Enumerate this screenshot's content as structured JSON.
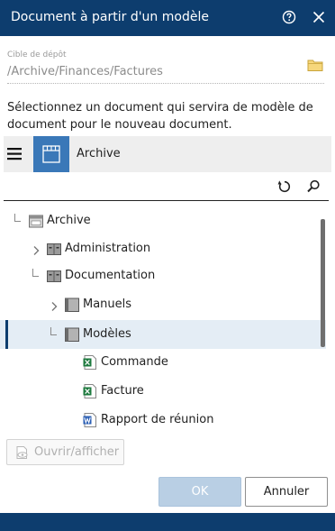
{
  "dialog": {
    "title": "Document à partir d'un modèle"
  },
  "titlebar_icons": [
    "help-icon",
    "close-icon"
  ],
  "target": {
    "label": "Cible de dépôt",
    "value": "/Archive/Finances/Factures",
    "icon": "folder-icon"
  },
  "instructions": "Sélectionnez un document qui servira de modèle de document pour le nouveau document.",
  "toolbar": {
    "archive_label": "Archive",
    "icons": [
      "menu-icon",
      "archive-icon",
      "refresh-icon",
      "search-icon"
    ]
  },
  "tree": {
    "items": [
      {
        "label": "Archive",
        "icon": "archive-root-icon",
        "expander": "none"
      },
      {
        "label": "Administration",
        "icon": "cabinet-icon",
        "expander": "collapsed"
      },
      {
        "label": "Documentation",
        "icon": "cabinet-icon",
        "expander": "expanded"
      },
      {
        "label": "Manuels",
        "icon": "folder-gray-icon",
        "expander": "collapsed"
      },
      {
        "label": "Modèles",
        "icon": "folder-gray-icon",
        "expander": "expanded",
        "selected": true
      },
      {
        "label": "Commande",
        "icon": "excel-file-icon",
        "expander": "none"
      },
      {
        "label": "Facture",
        "icon": "excel-file-icon",
        "expander": "none"
      },
      {
        "label": "Rapport de réunion",
        "icon": "word-file-icon",
        "expander": "none"
      }
    ]
  },
  "buttons": {
    "open": "Ouvrir/afficher",
    "ok": "OK",
    "cancel": "Annuler"
  },
  "colors": {
    "titlebar": "#0d3d6e",
    "accent": "#3a78b8",
    "selection": "#e4edf5",
    "ok_disabled": "#b9cfe4"
  }
}
